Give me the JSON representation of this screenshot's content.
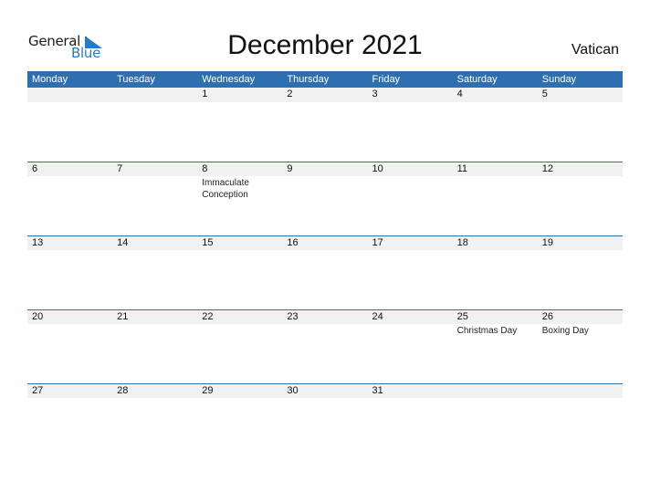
{
  "logo": {
    "part1": "General",
    "part2": "Blue",
    "brand_color": "#2a7bc4"
  },
  "title": "December 2021",
  "country": "Vatican",
  "colors": {
    "header_bg": "#2e6fb0",
    "date_strip_bg": "#f1f1f1"
  },
  "weekdays": [
    "Monday",
    "Tuesday",
    "Wednesday",
    "Thursday",
    "Friday",
    "Saturday",
    "Sunday"
  ],
  "weeks": [
    {
      "days": [
        {
          "date": "",
          "event": ""
        },
        {
          "date": "",
          "event": ""
        },
        {
          "date": "1",
          "event": ""
        },
        {
          "date": "2",
          "event": ""
        },
        {
          "date": "3",
          "event": ""
        },
        {
          "date": "4",
          "event": ""
        },
        {
          "date": "5",
          "event": ""
        }
      ]
    },
    {
      "days": [
        {
          "date": "6",
          "event": ""
        },
        {
          "date": "7",
          "event": ""
        },
        {
          "date": "8",
          "event": "Immaculate Conception"
        },
        {
          "date": "9",
          "event": ""
        },
        {
          "date": "10",
          "event": ""
        },
        {
          "date": "11",
          "event": ""
        },
        {
          "date": "12",
          "event": ""
        }
      ]
    },
    {
      "days": [
        {
          "date": "13",
          "event": ""
        },
        {
          "date": "14",
          "event": ""
        },
        {
          "date": "15",
          "event": ""
        },
        {
          "date": "16",
          "event": ""
        },
        {
          "date": "17",
          "event": ""
        },
        {
          "date": "18",
          "event": ""
        },
        {
          "date": "19",
          "event": ""
        }
      ]
    },
    {
      "days": [
        {
          "date": "20",
          "event": ""
        },
        {
          "date": "21",
          "event": ""
        },
        {
          "date": "22",
          "event": ""
        },
        {
          "date": "23",
          "event": ""
        },
        {
          "date": "24",
          "event": ""
        },
        {
          "date": "25",
          "event": "Christmas Day"
        },
        {
          "date": "26",
          "event": "Boxing Day"
        }
      ]
    },
    {
      "days": [
        {
          "date": "27",
          "event": ""
        },
        {
          "date": "28",
          "event": ""
        },
        {
          "date": "29",
          "event": ""
        },
        {
          "date": "30",
          "event": ""
        },
        {
          "date": "31",
          "event": ""
        },
        {
          "date": "",
          "event": ""
        },
        {
          "date": "",
          "event": ""
        }
      ]
    }
  ]
}
